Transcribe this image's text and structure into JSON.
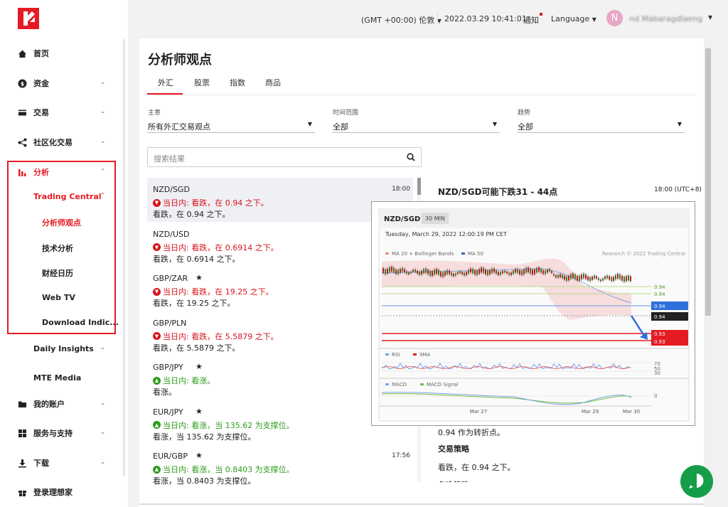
{
  "header": {
    "timezone": "(GMT +00:00) 伦敦",
    "datetime": "2022.03.29 10:41:01",
    "notifications": "通知",
    "language": "Language",
    "avatar_initial": "N",
    "username": "nd Mabaragdlaeng"
  },
  "sidebar": {
    "items": [
      {
        "label": "首页"
      },
      {
        "label": "资金"
      },
      {
        "label": "交易"
      },
      {
        "label": "社区化交易"
      },
      {
        "label": "分析"
      },
      {
        "label": "Daily Insights"
      },
      {
        "label": "MTE Media"
      },
      {
        "label": "我的账户"
      },
      {
        "label": "服务与支持"
      },
      {
        "label": "下载"
      },
      {
        "label": "登录理想家"
      }
    ],
    "trading_central": "Trading Central",
    "sub_items": [
      "分析师观点",
      "技术分析",
      "财经日历",
      "Web TV",
      "Download Indic..."
    ]
  },
  "main": {
    "title": "分析师观点",
    "tabs": [
      "外汇",
      "股票",
      "指数",
      "商品"
    ],
    "filters": [
      {
        "label": "主意",
        "value": "所有外汇交易观点"
      },
      {
        "label": "时间范围",
        "value": "全部"
      },
      {
        "label": "趋势",
        "value": "全部"
      }
    ],
    "search_placeholder": "搜索结果",
    "list": [
      {
        "pair": "NZD/SGD",
        "time": "18:00",
        "trend": "当日内: 看跌，在 0.94 之下。",
        "desc": "看跌，在 0.94 之下。",
        "dir": "down",
        "star": false
      },
      {
        "pair": "NZD/USD",
        "time": "",
        "trend": "当日内: 看跌，在 0.6914 之下。",
        "desc": "看跌，在 0.6914 之下。",
        "dir": "down",
        "star": false
      },
      {
        "pair": "GBP/ZAR",
        "time": "",
        "trend": "当日内: 看跌，在 19.25 之下。",
        "desc": "看跌，在 19.25 之下。",
        "dir": "down",
        "star": true
      },
      {
        "pair": "GBP/PLN",
        "time": "",
        "trend": "当日内: 看跌，在 5.5879 之下。",
        "desc": "看跌，在 5.5879 之下。",
        "dir": "down",
        "star": false
      },
      {
        "pair": "GBP/JPY",
        "time": "",
        "trend": "当日内: 看涨。",
        "desc": "看涨。",
        "dir": "up",
        "star": true
      },
      {
        "pair": "EUR/JPY",
        "time": "",
        "trend": "当日内: 看涨，当 135.62 为支撑位。",
        "desc": "看涨，当 135.62 为支撑位。",
        "dir": "up",
        "star": true
      },
      {
        "pair": "EUR/GBP",
        "time": "17:56",
        "trend": "当日内: 看涨，当 0.8403 为支撑位。",
        "desc": "看涨，当 0.8403 为支撑位。",
        "dir": "up",
        "star": true
      }
    ]
  },
  "detail": {
    "title": "NZD/SGD可能下跌31 - 44点",
    "time": "18:00 (UTC+8)",
    "pivot_text": "0.94 作为转折点。",
    "strategy_heading": "交易策略",
    "strategy_text": "看跌，在 0.94 之下。",
    "alt_heading": "备选策略"
  },
  "chart": {
    "symbol": "NZD/SGD",
    "interval": "30 MIN",
    "timestamp": "Tuesday, March 29, 2022 12:00:19 PM CET",
    "legend_ma": "MA 20 + Bollinger Bands",
    "legend_ma50": "MA 50",
    "watermark": "Research © 2022 Trading Central",
    "level_labels": [
      "0.94",
      "0.94",
      "0.94",
      "0.94",
      "0.93",
      "0.93"
    ],
    "rsi_label": "RSI",
    "rsi_ma_label": "9MA",
    "rsi_levels": [
      "70",
      "50",
      "30"
    ],
    "macd_label": "MACD",
    "macd_signal_label": "MACD Signal",
    "macd_zero": "0",
    "x_labels": [
      "Mar 27",
      "Mar 29",
      "Mar 30"
    ],
    "colors": {
      "red": "#e41b23",
      "blue": "#2f6fdb",
      "green": "#3fa63a"
    }
  }
}
